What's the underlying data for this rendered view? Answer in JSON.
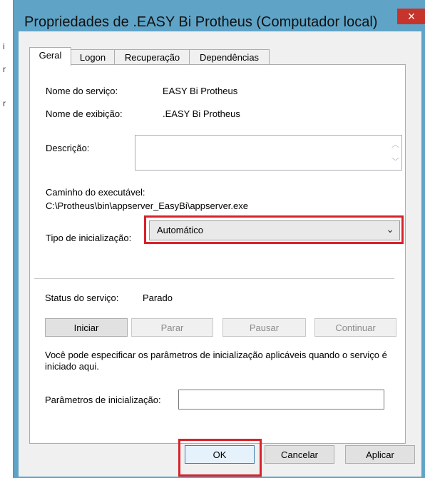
{
  "window": {
    "title": "Propriedades de .EASY Bi Protheus (Computador local)",
    "close_glyph": "×"
  },
  "background": {
    "fragments": [
      "i",
      "r",
      "r"
    ]
  },
  "tabs": [
    {
      "label": "Geral",
      "active": true
    },
    {
      "label": "Logon",
      "active": false
    },
    {
      "label": "Recuperação",
      "active": false
    },
    {
      "label": "Dependências",
      "active": false
    }
  ],
  "general": {
    "service_name_label": "Nome do serviço:",
    "service_name_value": "EASY Bi Protheus",
    "display_name_label": "Nome de exibição:",
    "display_name_value": ".EASY Bi Protheus",
    "description_label": "Descrição:",
    "description_value": "",
    "exe_path_label": "Caminho do executável:",
    "exe_path_value": "C:\\Protheus\\bin\\appserver_EasyBi\\appserver.exe",
    "startup_type_label": "Tipo de inicialização:",
    "startup_type_value": "Automático",
    "service_status_label": "Status do serviço:",
    "service_status_value": "Parado",
    "buttons": {
      "start": "Iniciar",
      "stop": "Parar",
      "pause": "Pausar",
      "resume": "Continuar"
    },
    "params_hint": "Você pode especificar os parâmetros de inicialização aplicáveis quando o serviço é iniciado aqui.",
    "params_label": "Parâmetros de inicialização:",
    "params_value": ""
  },
  "footer": {
    "ok": "OK",
    "cancel": "Cancelar",
    "apply": "Aplicar"
  },
  "colors": {
    "highlight": "#d8222b",
    "title_bar": "#5fa4c7",
    "close_button": "#c7342c"
  }
}
